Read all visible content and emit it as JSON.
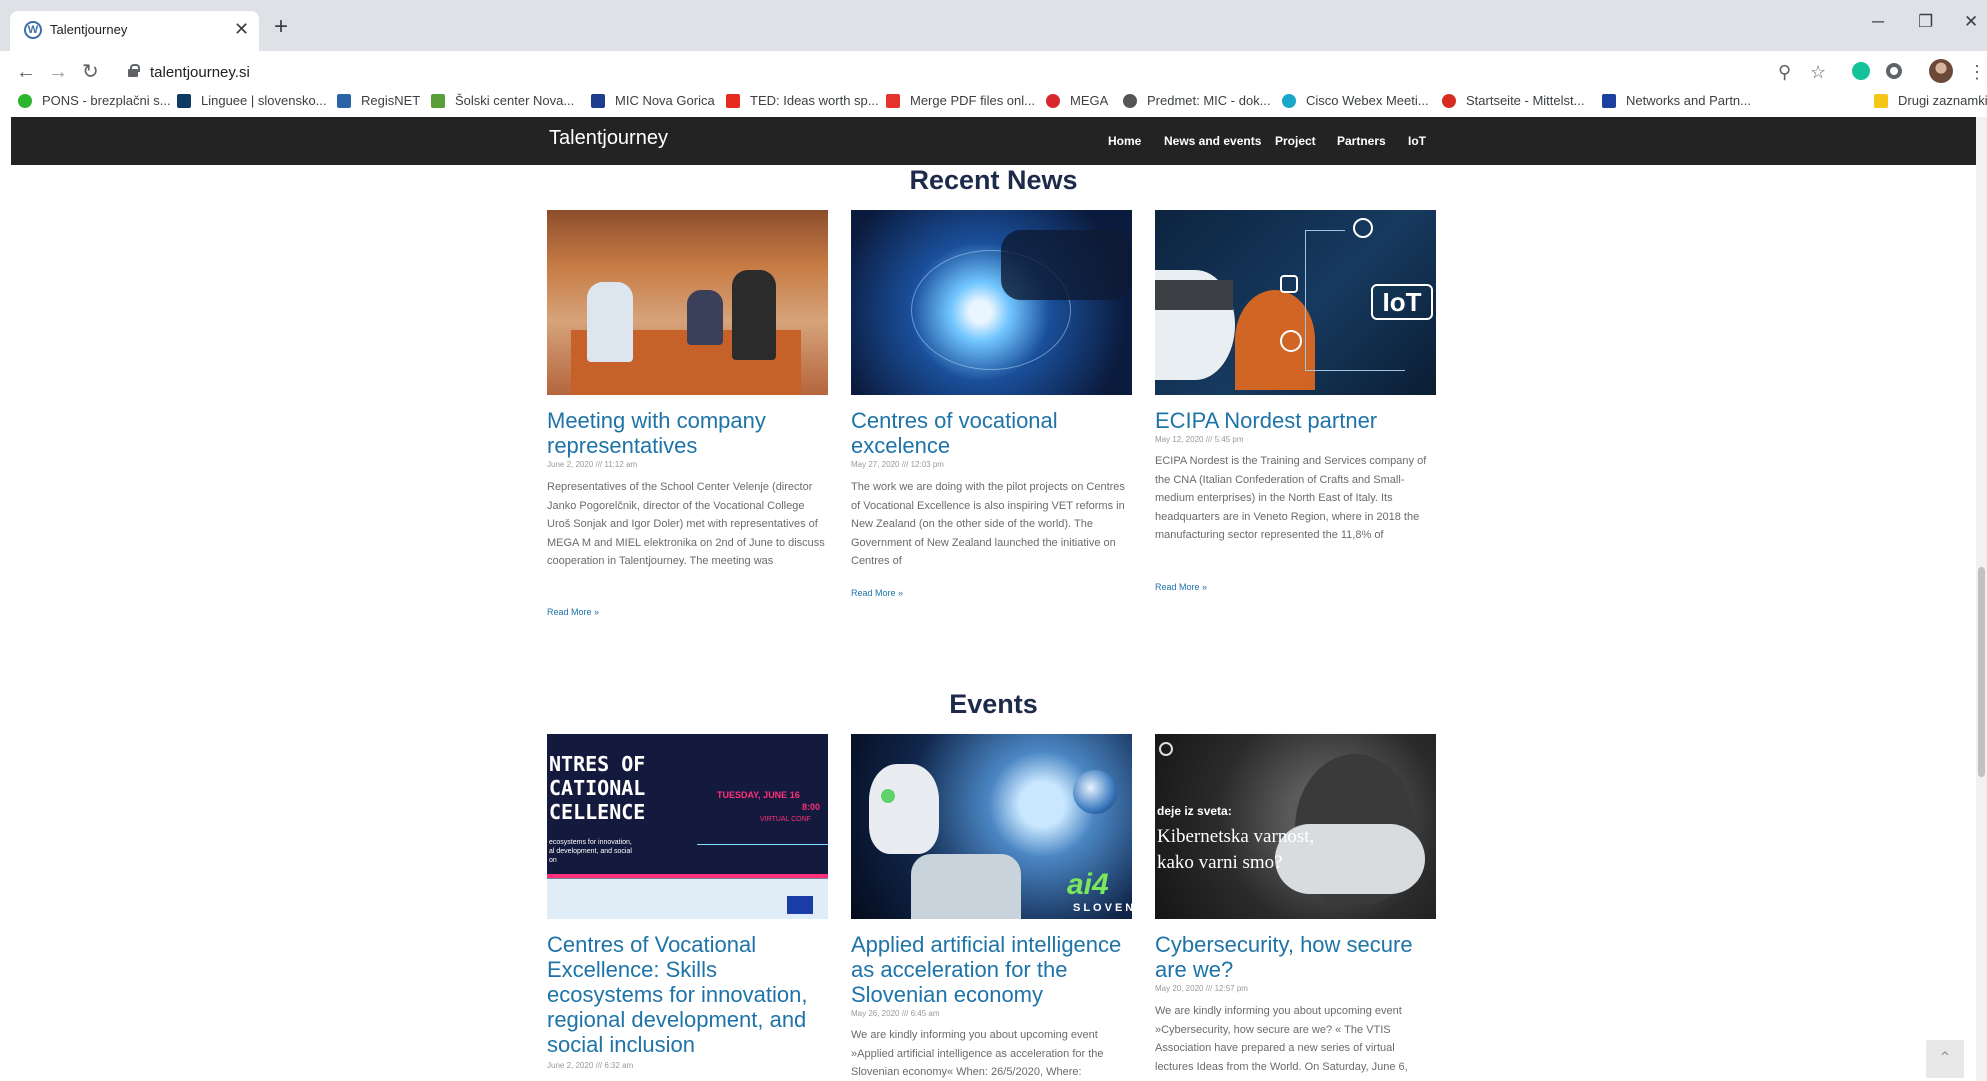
{
  "browser": {
    "tab_title": "Talentjourney",
    "tab_favicon_letter": "W",
    "close_glyph": "✕",
    "new_tab_glyph": "+",
    "url": "talentjourney.si",
    "window_controls": [
      "─",
      "❐",
      "✕"
    ],
    "nav_glyphs": {
      "back": "←",
      "forward": "→",
      "reload": "↻"
    },
    "toolbar_glyphs": {
      "zoom": "⚲",
      "star": "☆",
      "menu": "⋮"
    }
  },
  "bookmarks": [
    {
      "label": "PONS - brezplačni s...",
      "color": "#2db52d"
    },
    {
      "label": "Linguee | slovensko...",
      "color": "#0f3a64"
    },
    {
      "label": "RegisNET",
      "color": "#2a63a8"
    },
    {
      "label": "Šolski center Nova...",
      "color": "#5a9e3a"
    },
    {
      "label": "MIC Nova Gorica",
      "color": "#1e3d8f"
    },
    {
      "label": "TED: Ideas worth sp...",
      "color": "#e62b1e"
    },
    {
      "label": "Merge PDF files onl...",
      "color": "#e5322d"
    },
    {
      "label": "MEGA",
      "color": "#d9272e"
    },
    {
      "label": "Predmet: MIC - dok...",
      "color": "#555555"
    },
    {
      "label": "Cisco Webex Meeti...",
      "color": "#18a6c9"
    },
    {
      "label": "Startseite - Mittelst...",
      "color": "#d62d20"
    },
    {
      "label": "Networks and Partn...",
      "color": "#1c3fa0"
    },
    {
      "label": "Drugi zaznamki",
      "color": "#f5c518"
    }
  ],
  "site": {
    "brand": "Talentjourney",
    "menu": [
      "Home",
      "News and events",
      "Project",
      "Partners",
      "IoT"
    ],
    "recent_news_title": "Recent News",
    "events_title": "Events",
    "read_more": "Read More »",
    "news": [
      {
        "title": "Meeting with company representatives",
        "date": "June 2, 2020 /// 11:12 am",
        "excerpt": "Representatives of the School Center Velenje (director Janko Pogorelčnik, director of the Vocational College Uroš Sonjak and Igor Doler) met with representatives of MEGA M and MIEL elektronika on 2nd of June to discuss cooperation in Talentjourney. The meeting was"
      },
      {
        "title": "Centres of vocational excelence",
        "date": "May 27, 2020 /// 12:03 pm",
        "excerpt": "The work we are doing with the pilot projects on Centres of Vocational Excellence is also inspiring VET reforms in New Zealand (on the other side of the world). The Government of New Zealand launched the initiative on Centres of"
      },
      {
        "title": "ECIPA Nordest partner",
        "date": "May 12, 2020 /// 5:45 pm",
        "excerpt": "ECIPA Nordest is the Training and Services company of the CNA (Italian Confederation of Crafts and Small-medium enterprises) in the North East of Italy. Its headquarters are in Veneto Region, where in 2018 the manufacturing sector represented the 11,8% of"
      }
    ],
    "events": [
      {
        "title": "Centres of Vocational Excellence: Skills ecosystems for innovation, regional development, and social inclusion",
        "date": "June 2, 2020 /// 6:32 am",
        "excerpt": ""
      },
      {
        "title": "Applied artificial intelligence as acceleration for the Slovenian economy",
        "date": "May 26, 2020 /// 6:45 am",
        "excerpt": "We are kindly informing you about upcoming event »Applied artificial intelligence as acceleration for the Slovenian economy« When: 26/5/2020, Where:"
      },
      {
        "title": "Cybersecurity, how secure are we?",
        "date": "May 20, 2020 /// 12:57 pm",
        "excerpt": "We are kindly informing you about upcoming event »Cybersecurity, how secure are we? « The VTIS Association have prepared a new series of virtual lectures Ideas from the World. On Saturday, June 6,"
      }
    ],
    "thumb_text": {
      "iot": "IoT",
      "cove_lines": [
        "NTRES OF",
        "CATIONAL",
        "CELLENCE"
      ],
      "cove_date": "TUESDAY, JUNE 16",
      "cove_time": "8:00",
      "cove_virtual": "VIRTUAL CONF",
      "cove_sub": [
        "ecosystems for innovation,",
        "al development, and social",
        "on"
      ],
      "ai_logo": "ai4",
      "ai_sub": "SLOVEN",
      "cyber_kicker": "deje iz sveta:",
      "cyber_lines": [
        "Kibernetska varnost,",
        "kako varni smo?"
      ]
    },
    "to_top_glyph": "⌃"
  }
}
